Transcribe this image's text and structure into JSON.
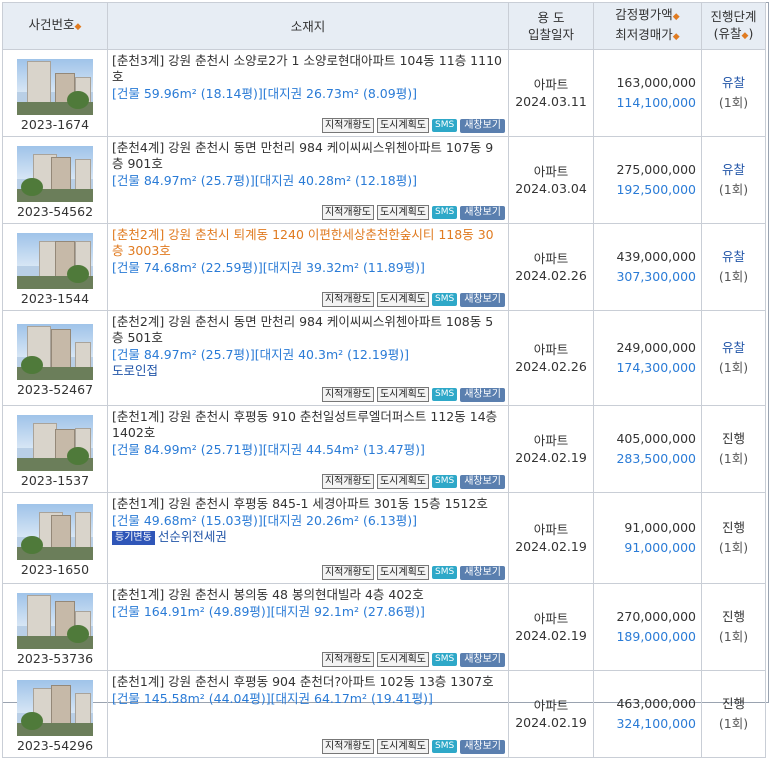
{
  "header": {
    "case_no": "사건번호",
    "location": "소재지",
    "use_line1": "용 도",
    "use_line2": "입찰일자",
    "price_line1": "감정평가액",
    "price_line2": "최저경매가",
    "status_line1": "진행단계",
    "status_line2": "(유찰",
    "status_line2_end": ")",
    "sort_glyph": "◆"
  },
  "buttons": {
    "cadastral": "지적개황도",
    "city_plan": "도시계획도",
    "sms": "SMS",
    "new_window": "새창보기"
  },
  "rows": [
    {
      "case_no": "2023-1674",
      "address": "[춘천3계] 강원 춘천시 소양로2가 1 소양로현대아파트 104동 11층 1110호",
      "area": "[건물 59.96m² (18.14평)][대지권 26.73m² (8.09평)]",
      "note": "",
      "badge": "",
      "use": "아파트",
      "date": "2024.03.11",
      "appraisal": "163,000,000",
      "min_price": "114,100,000",
      "status": "유찰",
      "count": "(1회)",
      "failed": true,
      "selected": false
    },
    {
      "case_no": "2023-54562",
      "address": "[춘천4계] 강원 춘천시 동면 만천리 984 케이씨씨스위첸아파트 107동 9층 901호",
      "area": "[건물 84.97m² (25.7평)][대지권 40.28m² (12.18평)]",
      "note": "",
      "badge": "",
      "use": "아파트",
      "date": "2024.03.04",
      "appraisal": "275,000,000",
      "min_price": "192,500,000",
      "status": "유찰",
      "count": "(1회)",
      "failed": true,
      "selected": false
    },
    {
      "case_no": "2023-1544",
      "address": "[춘천2계] 강원 춘천시 퇴계동 1240 이편한세상춘천한숲시티 118동 30층 3003호",
      "area": "[건물 74.68m² (22.59평)][대지권 39.32m² (11.89평)]",
      "note": "",
      "badge": "",
      "use": "아파트",
      "date": "2024.02.26",
      "appraisal": "439,000,000",
      "min_price": "307,300,000",
      "status": "유찰",
      "count": "(1회)",
      "failed": true,
      "selected": true
    },
    {
      "case_no": "2023-52467",
      "address": "[춘천2계] 강원 춘천시 동면 만천리 984 케이씨씨스위첸아파트 108동 5층 501호",
      "area": "[건물 84.97m² (25.7평)][대지권 40.3m² (12.19평)]",
      "note": "도로인접",
      "badge": "",
      "use": "아파트",
      "date": "2024.02.26",
      "appraisal": "249,000,000",
      "min_price": "174,300,000",
      "status": "유찰",
      "count": "(1회)",
      "failed": true,
      "selected": false
    },
    {
      "case_no": "2023-1537",
      "address": "[춘천1계] 강원 춘천시 후평동 910 춘천일성트루엘더퍼스트 112동 14층 1402호",
      "area": "[건물 84.99m² (25.71평)][대지권 44.54m² (13.47평)]",
      "note": "",
      "badge": "",
      "use": "아파트",
      "date": "2024.02.19",
      "appraisal": "405,000,000",
      "min_price": "283,500,000",
      "status": "진행",
      "count": "(1회)",
      "failed": false,
      "selected": false
    },
    {
      "case_no": "2023-1650",
      "address": "[춘천1계] 강원 춘천시 후평동 845-1 세경아파트 301동 15층 1512호",
      "area": "[건물 49.68m² (15.03평)][대지권 20.26m² (6.13평)]",
      "note": "선순위전세권",
      "badge": "등기변동",
      "use": "아파트",
      "date": "2024.02.19",
      "appraisal": "91,000,000",
      "min_price": "91,000,000",
      "status": "진행",
      "count": "(1회)",
      "failed": false,
      "selected": false
    },
    {
      "case_no": "2023-53736",
      "address": "[춘천1계] 강원 춘천시 봉의동 48 봉의현대빌라 4층 402호",
      "area": "[건물 164.91m² (49.89평)][대지권 92.1m² (27.86평)]",
      "note": "",
      "badge": "",
      "use": "아파트",
      "date": "2024.02.19",
      "appraisal": "270,000,000",
      "min_price": "189,000,000",
      "status": "진행",
      "count": "(1회)",
      "failed": false,
      "selected": false
    },
    {
      "case_no": "2023-54296",
      "address": "[춘천1계] 강원 춘천시 후평동 904 춘천더?아파트 102동 13층 1307호",
      "area": "[건물 145.58m² (44.04평)][대지권 64.17m² (19.41평)]",
      "note": "",
      "badge": "",
      "use": "아파트",
      "date": "2024.02.19",
      "appraisal": "463,000,000",
      "min_price": "324,100,000",
      "status": "진행",
      "count": "(1회)",
      "failed": false,
      "selected": false
    }
  ]
}
